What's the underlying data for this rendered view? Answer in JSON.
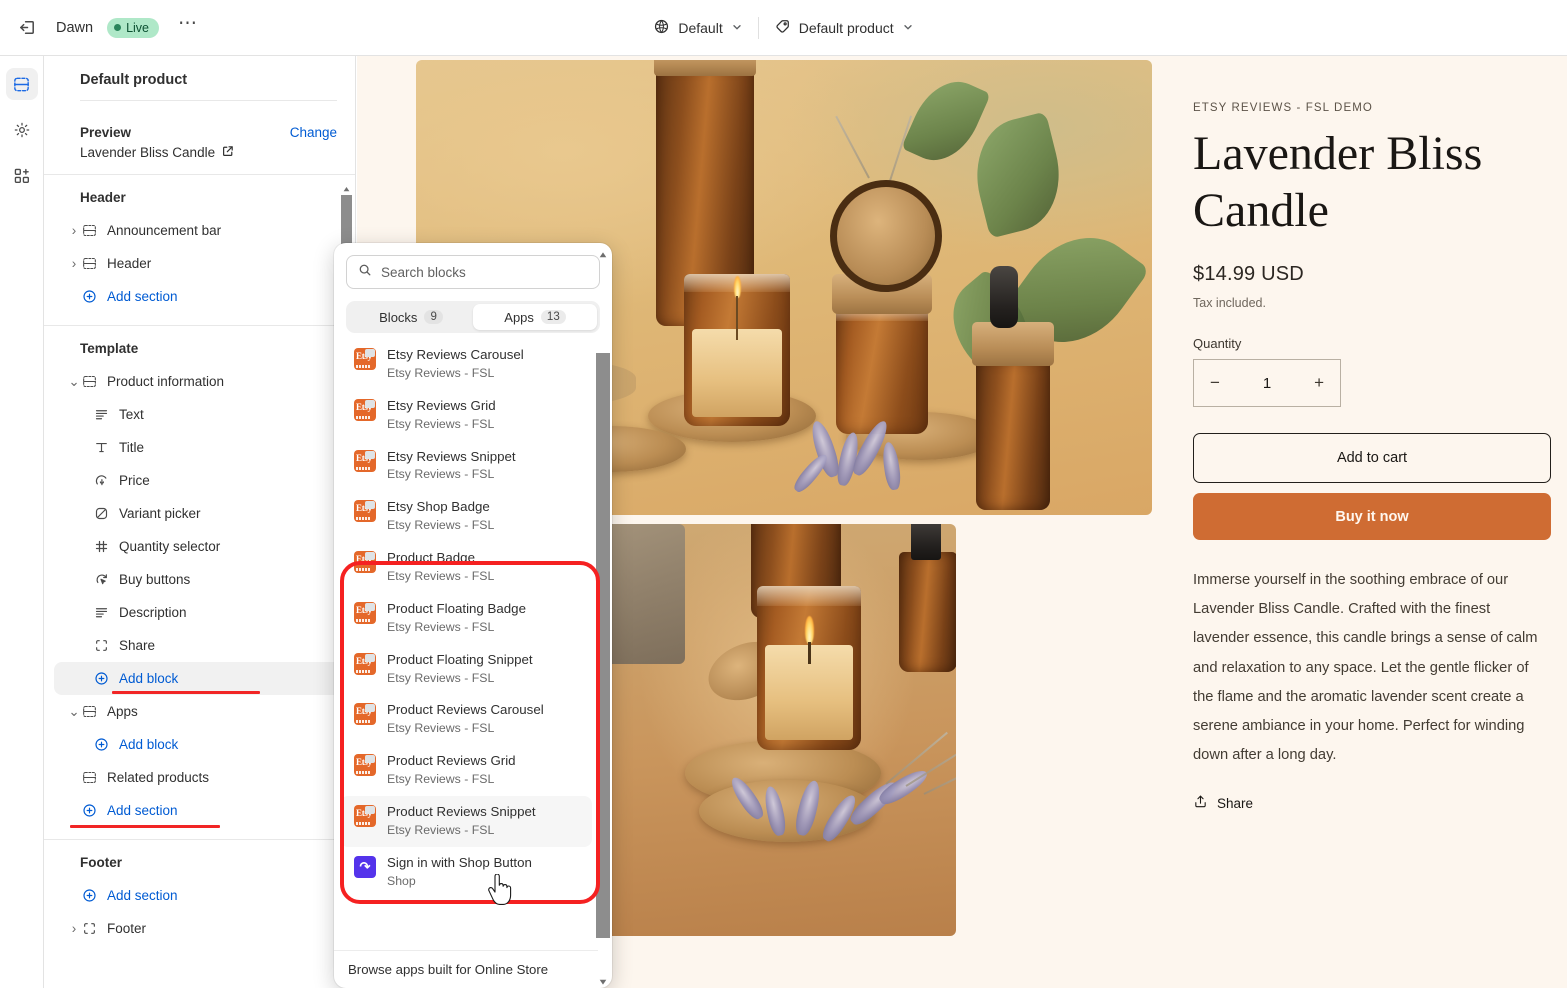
{
  "topbar": {
    "exit_icon": "exit-icon",
    "theme_name": "Dawn",
    "status_badge": "Live",
    "more_icon": "more-menu-icon",
    "locale_icon": "globe-icon",
    "locale_label": "Default",
    "template_icon": "tag-icon",
    "template_label": "Default product",
    "chevron": "⌄"
  },
  "rail": {
    "items": [
      {
        "name": "sections-icon",
        "label": "Sections"
      },
      {
        "name": "settings-icon",
        "label": "Theme settings"
      },
      {
        "name": "apps-icon",
        "label": "Apps"
      }
    ]
  },
  "sidebar": {
    "title": "Default product",
    "preview_label": "Preview",
    "change_label": "Change",
    "preview_value": "Lavender Bliss Candle",
    "external_icon": "external-link-icon",
    "groups": [
      {
        "title": "Header",
        "items": [
          {
            "label": "Announcement bar",
            "icon": "section-icon",
            "caret": "›",
            "type": "section"
          },
          {
            "label": "Header",
            "icon": "section-icon",
            "caret": "›",
            "type": "section"
          },
          {
            "label": "Add section",
            "icon": "plus-circle-icon",
            "type": "link"
          }
        ]
      },
      {
        "title": "Template",
        "items": [
          {
            "label": "Product information",
            "icon": "section-icon",
            "caret": "⌄",
            "type": "section"
          },
          {
            "label": "Text",
            "icon": "text-icon",
            "type": "block"
          },
          {
            "label": "Title",
            "icon": "title-icon",
            "type": "block"
          },
          {
            "label": "Price",
            "icon": "price-icon",
            "type": "block"
          },
          {
            "label": "Variant picker",
            "icon": "variant-icon",
            "type": "block"
          },
          {
            "label": "Quantity selector",
            "icon": "hash-icon",
            "type": "block"
          },
          {
            "label": "Buy buttons",
            "icon": "cursor-click-icon",
            "type": "block"
          },
          {
            "label": "Description",
            "icon": "text-icon",
            "type": "block"
          },
          {
            "label": "Share",
            "icon": "share-frame-icon",
            "type": "block"
          },
          {
            "label": "Add block",
            "icon": "plus-circle-icon",
            "type": "link-selected",
            "underline": true
          },
          {
            "label": "Apps",
            "icon": "section-icon",
            "caret": "⌄",
            "type": "section"
          },
          {
            "label": "Add block",
            "icon": "plus-circle-icon",
            "type": "link-indent"
          },
          {
            "label": "Related products",
            "icon": "section-icon",
            "type": "section-noarrow"
          },
          {
            "label": "Add section",
            "icon": "plus-circle-icon",
            "type": "link",
            "underline": true
          }
        ]
      },
      {
        "title": "Footer",
        "items": [
          {
            "label": "Add section",
            "icon": "plus-circle-icon",
            "type": "link"
          },
          {
            "label": "Footer",
            "icon": "section-icon",
            "caret": "›",
            "type": "section"
          }
        ]
      }
    ]
  },
  "popover": {
    "search_placeholder": "Search blocks",
    "search_value": "",
    "search_icon": "search-icon",
    "tabs": [
      {
        "label": "Blocks",
        "count": "9",
        "active": false
      },
      {
        "label": "Apps",
        "count": "13",
        "active": true
      }
    ],
    "apps": [
      {
        "name": "Etsy Reviews Carousel",
        "sub": "Etsy Reviews - FSL",
        "icon": "etsy-app-icon"
      },
      {
        "name": "Etsy Reviews Grid",
        "sub": "Etsy Reviews - FSL",
        "icon": "etsy-app-icon"
      },
      {
        "name": "Etsy Reviews Snippet",
        "sub": "Etsy Reviews - FSL",
        "icon": "etsy-app-icon"
      },
      {
        "name": "Etsy Shop Badge",
        "sub": "Etsy Reviews - FSL",
        "icon": "etsy-app-icon"
      },
      {
        "name": "Product Badge",
        "sub": "Etsy Reviews - FSL",
        "icon": "etsy-app-icon"
      },
      {
        "name": "Product Floating Badge",
        "sub": "Etsy Reviews - FSL",
        "icon": "etsy-app-icon"
      },
      {
        "name": "Product Floating Snippet",
        "sub": "Etsy Reviews - FSL",
        "icon": "etsy-app-icon"
      },
      {
        "name": "Product Reviews Carousel",
        "sub": "Etsy Reviews - FSL",
        "icon": "etsy-app-icon"
      },
      {
        "name": "Product Reviews Grid",
        "sub": "Etsy Reviews - FSL",
        "icon": "etsy-app-icon"
      },
      {
        "name": "Product Reviews Snippet",
        "sub": "Etsy Reviews - FSL",
        "icon": "etsy-app-icon",
        "hovered": true
      },
      {
        "name": "Sign in with Shop Button",
        "sub": "Shop",
        "icon": "shop-app-icon"
      }
    ],
    "footer_link": "Browse apps built for Online Store"
  },
  "product": {
    "vendor": "ETSY REVIEWS - FSL DEMO",
    "title": "Lavender Bliss Candle",
    "price": "$14.99 USD",
    "tax_note": "Tax included.",
    "quantity_label": "Quantity",
    "quantity_value": "1",
    "minus": "−",
    "plus": "+",
    "add_to_cart": "Add to cart",
    "buy_now": "Buy it now",
    "description": "Immerse yourself in the soothing embrace of our Lavender Bliss Candle. Crafted with the finest lavender essence, this candle brings a sense of calm and relaxation to any space. Let the gentle flicker of the flame and the aromatic lavender scent create a serene ambiance in your home. Perfect for winding down after a long day.",
    "share_label": "Share",
    "share_icon": "share-icon"
  },
  "colors": {
    "accent_link": "#005bd3",
    "buy_now": "#cf6c33",
    "live_badge_bg": "#afe8c8",
    "annotation_red": "#f52121",
    "etsy_orange": "#e4682a",
    "canvas_bg": "#fdf6ee"
  }
}
